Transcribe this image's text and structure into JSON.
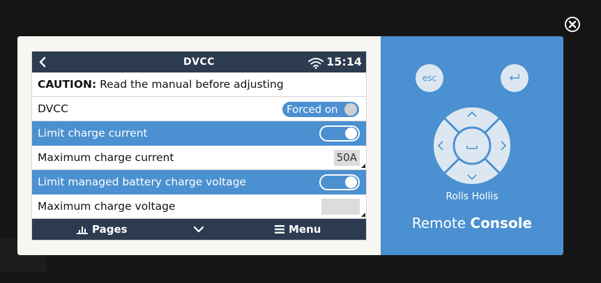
{
  "device": {
    "title": "DVCC",
    "time": "15:14",
    "rows": [
      {
        "bold": "CAUTION:",
        "label": " Read the manual before adjusting"
      },
      {
        "label": "DVCC",
        "value": "Forced on"
      },
      {
        "label": "Limit charge current"
      },
      {
        "label": "Maximum charge current",
        "value": "50A"
      },
      {
        "label": "Limit managed battery charge voltage"
      },
      {
        "label": "Maximum charge voltage",
        "value": ""
      }
    ],
    "bottom": {
      "pages": "Pages",
      "menu": "Menu"
    }
  },
  "console": {
    "esc": "esc",
    "device_name": "Rolls Hollis",
    "label_part1": "Remote ",
    "label_part2": "Console"
  },
  "colors": {
    "accent": "#4b90d0",
    "bar": "#2c3b4f"
  }
}
